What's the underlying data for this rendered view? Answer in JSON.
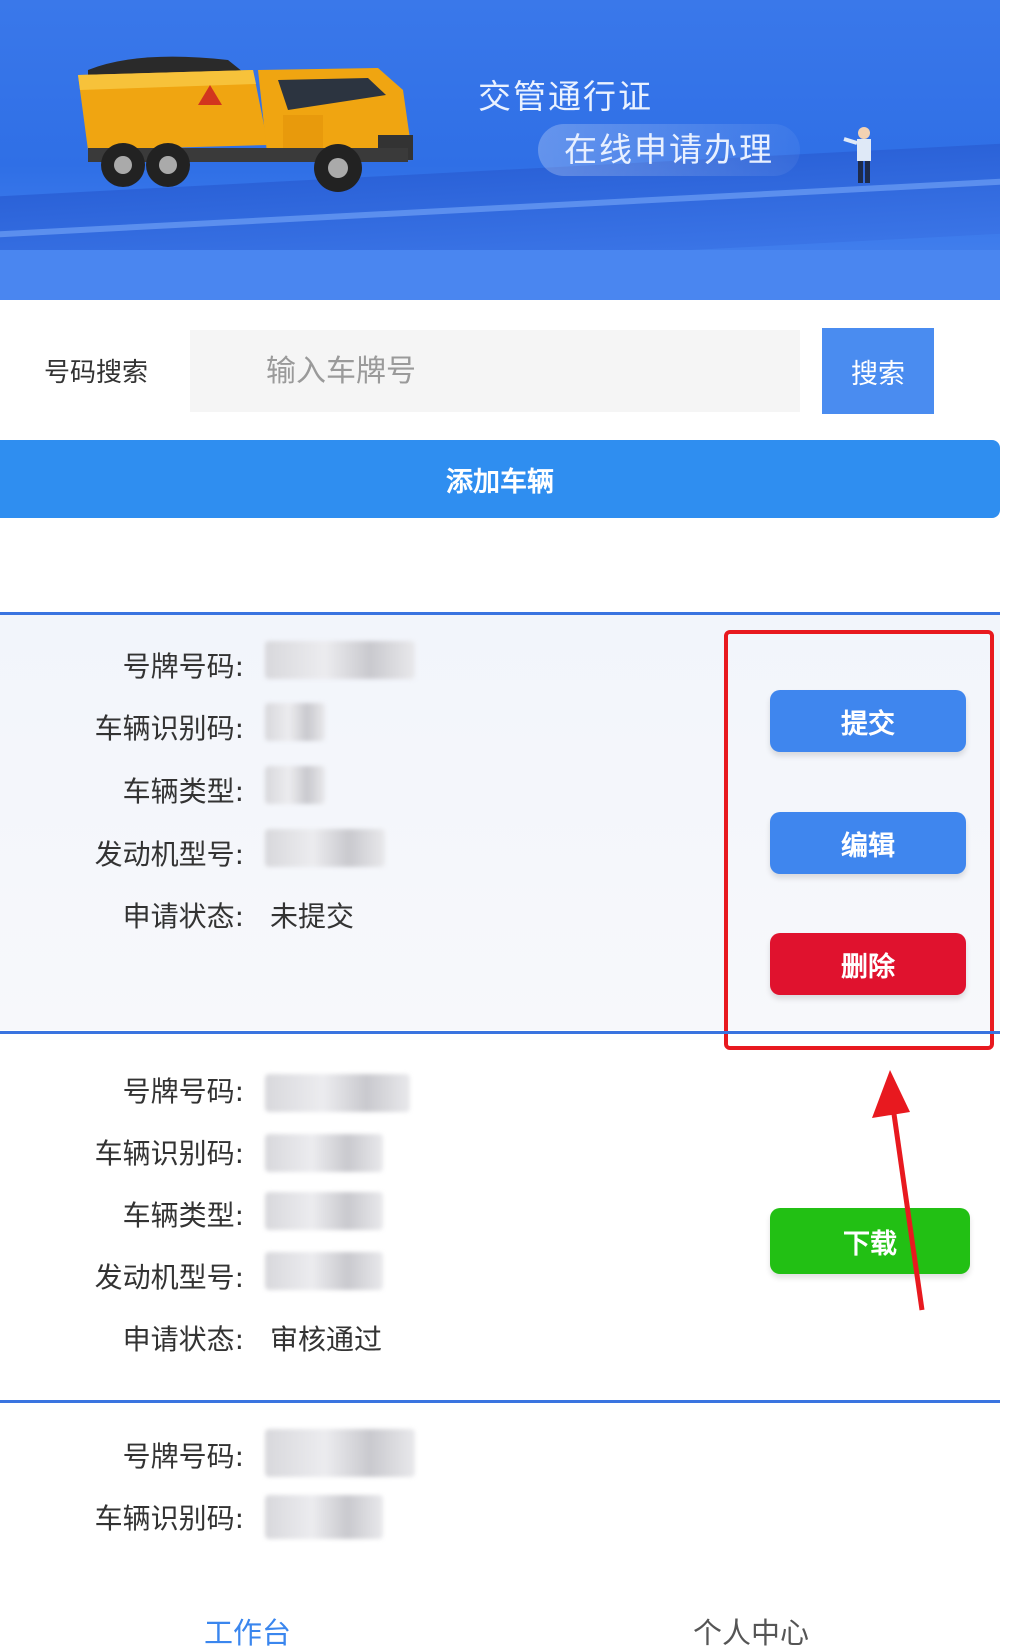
{
  "banner": {
    "title": "交管通行证",
    "subtitle": "在线申请办理"
  },
  "search": {
    "label": "号码搜索",
    "placeholder": "输入车牌号",
    "button": "搜索"
  },
  "add_vehicle_label": "添加车辆",
  "field_labels": {
    "plate": "号牌号码:",
    "vin": "车辆识别码:",
    "type": "车辆类型:",
    "engine": "发动机型号:",
    "status": "申请状态:"
  },
  "vehicles": [
    {
      "status": "未提交",
      "actions": {
        "submit": "提交",
        "edit": "编辑",
        "delete": "删除"
      }
    },
    {
      "status": "审核通过",
      "actions": {
        "download": "下载"
      }
    },
    {}
  ],
  "tabs": [
    {
      "label": "工作台",
      "active": true
    },
    {
      "label": "个人中心",
      "active": false
    }
  ],
  "colors": {
    "primary": "#2f8ef0",
    "delete": "#e0122e",
    "download": "#22c014",
    "highlight": "#e8191f"
  }
}
